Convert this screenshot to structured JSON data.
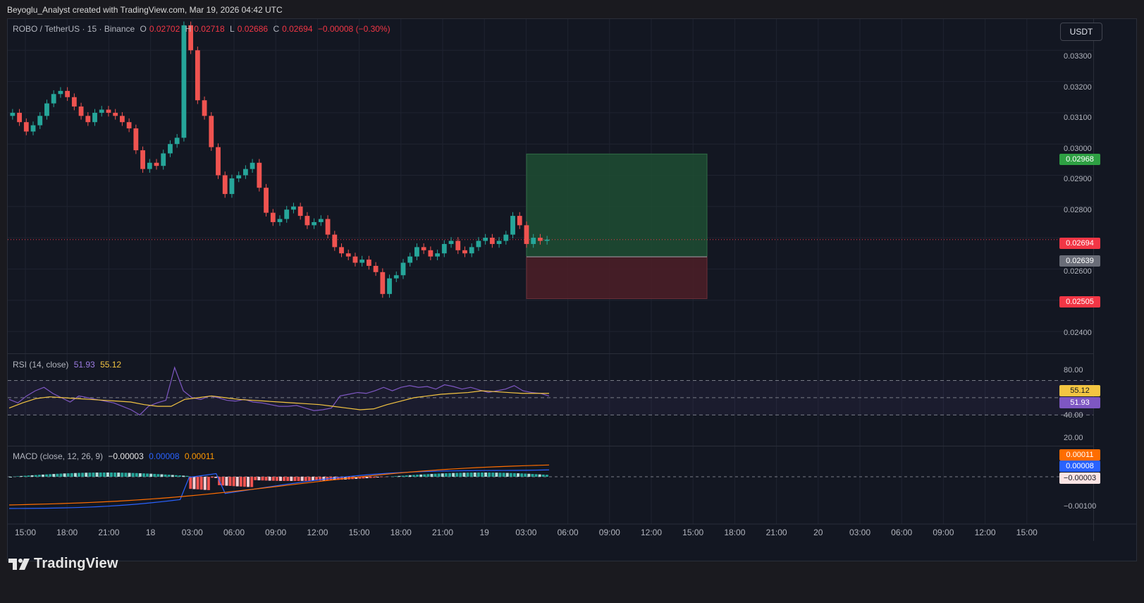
{
  "watermark": "Beyoglu_Analyst created with TradingView.com, Mar 19, 2026 04:42 UTC",
  "brand": "TradingView",
  "currency_button": "USDT",
  "legend": {
    "symbol": "ROBO / TetherUS · 15 · Binance",
    "open_label": "O",
    "open": "0.02702",
    "high_label": "H",
    "high": "0.02718",
    "low_label": "L",
    "low": "0.02686",
    "close_label": "C",
    "close": "0.02694",
    "change": "−0.00008 (−0.30%)"
  },
  "price_axis": [
    "0.03300",
    "0.03200",
    "0.03100",
    "0.03000",
    "0.02900",
    "0.02800",
    "0.02600",
    "0.02400"
  ],
  "price_badges": {
    "target": "0.02968",
    "current": "0.02694",
    "entry": "0.02639",
    "stop": "0.02505"
  },
  "rsi": {
    "label": "RSI (14, close)",
    "value": "51.93",
    "ma": "55.12",
    "axis": [
      "80.00",
      "40.00",
      "20.00"
    ]
  },
  "macd": {
    "label": "MACD (close, 12, 26, 9)",
    "hist": "−0.00003",
    "macd": "0.00008",
    "signal": "0.00011",
    "axis": [
      "−0.00100"
    ],
    "badge_hist": "−0.00003",
    "badge_macd": "0.00008",
    "badge_signal": "0.00011"
  },
  "time_axis": [
    "15:00",
    "18:00",
    "21:00",
    "18",
    "03:00",
    "06:00",
    "09:00",
    "12:00",
    "15:00",
    "18:00",
    "21:00",
    "19",
    "03:00",
    "06:00",
    "09:00",
    "12:00",
    "15:00",
    "18:00",
    "21:00",
    "20",
    "03:00",
    "06:00",
    "09:00",
    "12:00",
    "15:00"
  ],
  "colors": {
    "up": "#26a69a",
    "down": "#ef5350",
    "rsi": "#7e57c2",
    "rsi_ma": "#f4c542",
    "macd_line": "#2962ff",
    "signal_line": "#ff6d00",
    "target_zone": "#1e4d33",
    "stop_zone": "#4d1f27"
  },
  "chart_data": {
    "type": "candlestick",
    "y_range": [
      0.0233,
      0.034
    ],
    "position": {
      "target": 0.02968,
      "entry": 0.02639,
      "stop": 0.02505
    },
    "close_series": [
      0.031,
      0.0307,
      0.0304,
      0.0306,
      0.0309,
      0.0313,
      0.0316,
      0.0317,
      0.0315,
      0.0312,
      0.0309,
      0.0307,
      0.031,
      0.0311,
      0.031,
      0.0309,
      0.0307,
      0.0305,
      0.0298,
      0.0292,
      0.0294,
      0.0293,
      0.0297,
      0.03,
      0.0302,
      0.0338,
      0.033,
      0.0314,
      0.0309,
      0.0299,
      0.029,
      0.0284,
      0.0289,
      0.029,
      0.0292,
      0.0294,
      0.0286,
      0.0278,
      0.0275,
      0.0276,
      0.0279,
      0.028,
      0.0277,
      0.0274,
      0.0275,
      0.0276,
      0.0271,
      0.0267,
      0.0265,
      0.0264,
      0.0262,
      0.0263,
      0.0261,
      0.0259,
      0.0252,
      0.0257,
      0.0258,
      0.0262,
      0.0264,
      0.0267,
      0.0266,
      0.0264,
      0.0265,
      0.0268,
      0.0269,
      0.0266,
      0.0265,
      0.0267,
      0.0269,
      0.027,
      0.0268,
      0.0269,
      0.0271,
      0.0277,
      0.0274,
      0.0268,
      0.027,
      0.0269,
      0.02694
    ],
    "rsi": [
      48,
      44,
      52,
      58,
      62,
      55,
      50,
      45,
      52,
      50,
      48,
      46,
      44,
      40,
      36,
      30,
      40,
      44,
      47,
      85,
      58,
      50,
      48,
      52,
      50,
      47,
      46,
      48,
      45,
      44,
      42,
      40,
      40,
      41,
      38,
      35,
      36,
      38,
      52,
      54,
      56,
      55,
      58,
      62,
      58,
      62,
      64,
      62,
      63,
      60,
      65,
      63,
      60,
      62,
      59,
      56,
      58,
      60,
      64,
      58,
      56,
      55,
      52
    ],
    "rsi_ma": [
      38,
      44,
      49,
      51,
      50,
      49,
      48,
      47,
      46,
      45,
      42,
      40,
      40,
      48,
      50,
      52,
      50,
      48,
      47,
      46,
      45,
      44,
      43,
      42,
      40,
      38,
      36,
      37,
      42,
      46,
      50,
      52,
      54,
      55,
      56,
      58,
      57,
      56,
      55,
      55,
      55
    ]
  }
}
